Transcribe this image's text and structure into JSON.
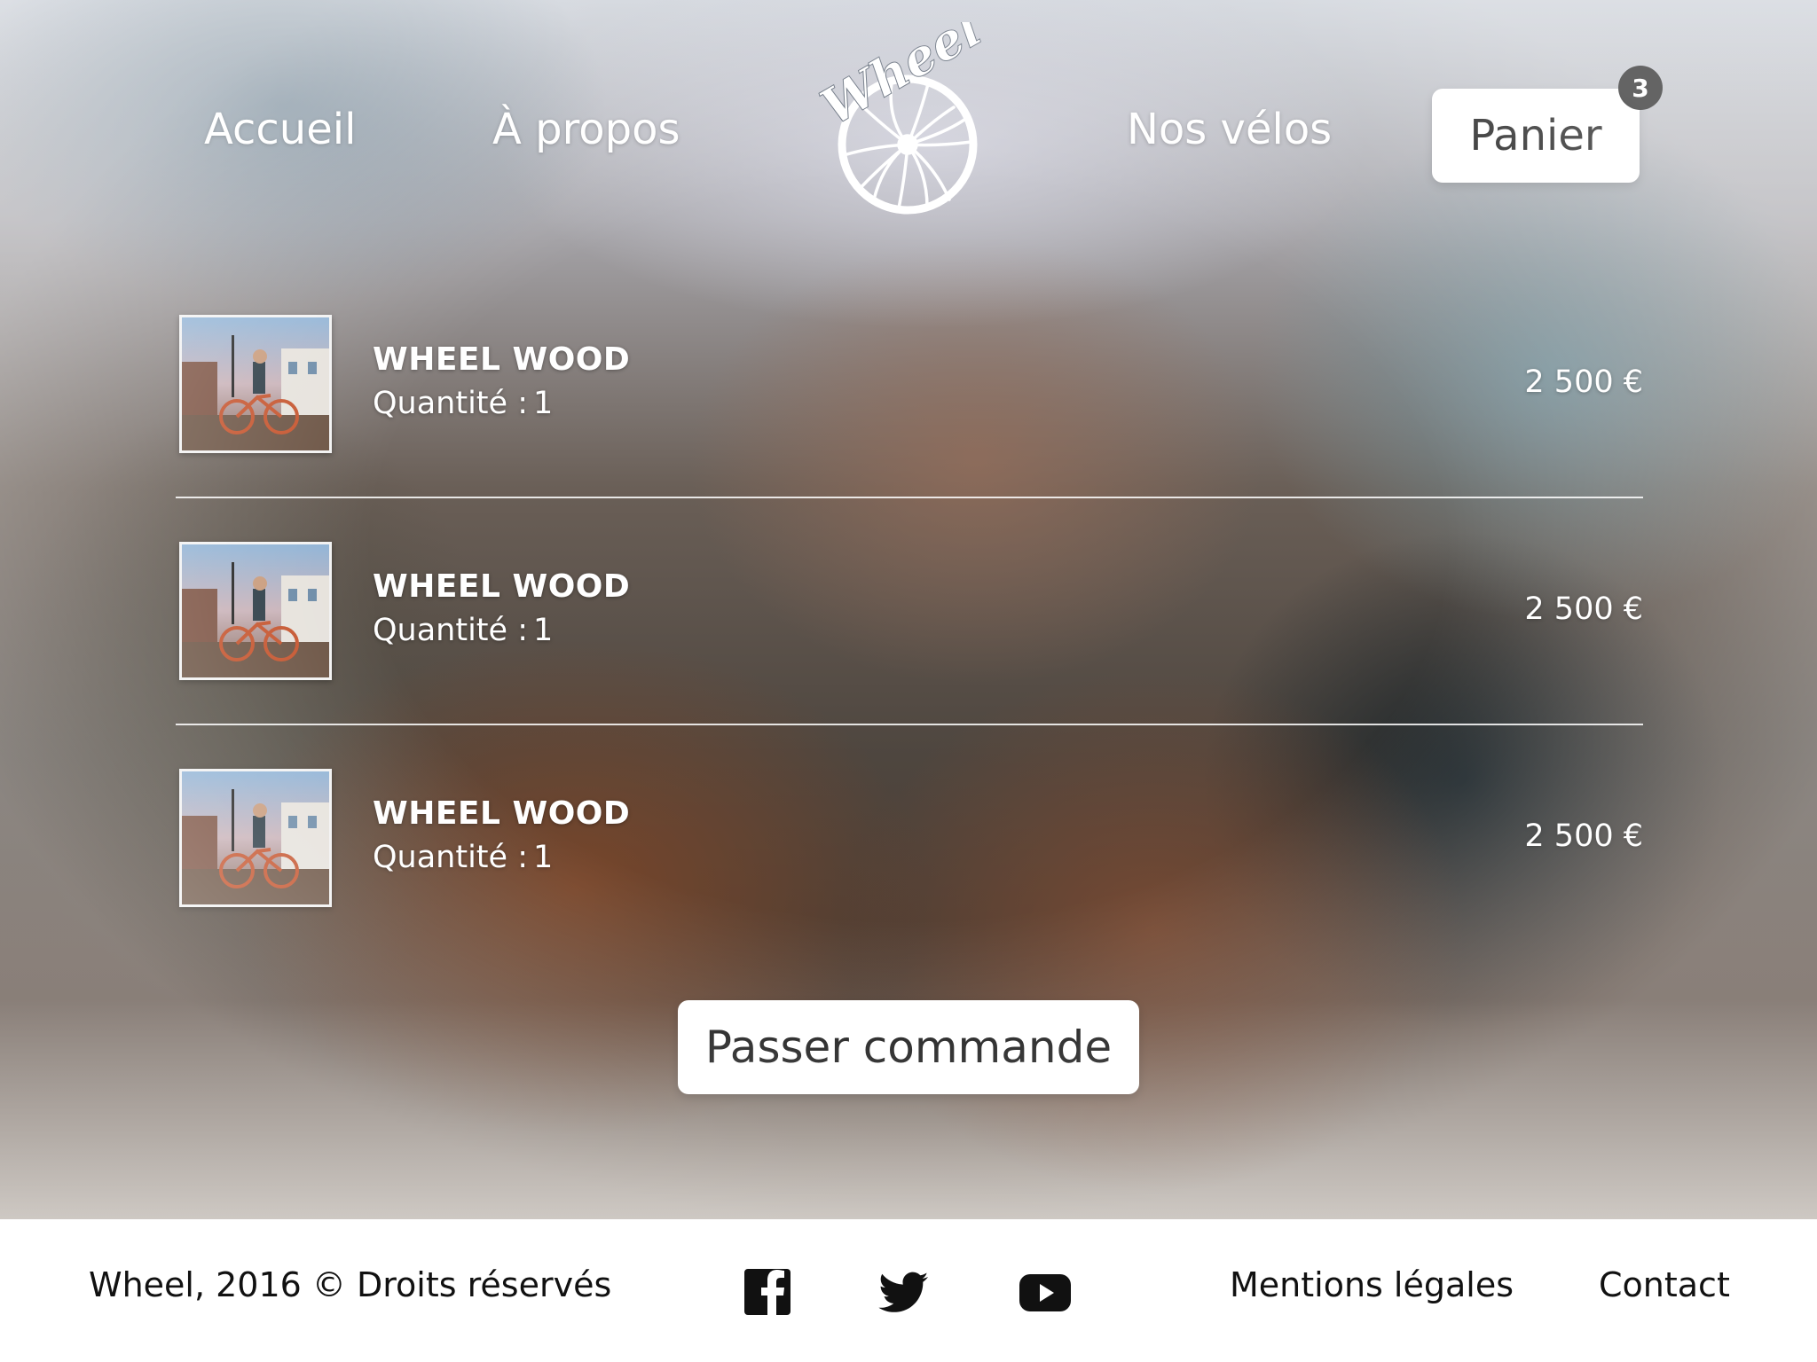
{
  "nav": {
    "home": "Accueil",
    "about": "À propos",
    "bikes": "Nos vélos",
    "cart": "Panier",
    "cart_count": "3",
    "logo_text": "Wheel"
  },
  "cart": {
    "items": [
      {
        "name": "WHEEL WOOD",
        "qty_label": "Quantité :",
        "qty": "1",
        "price": "2 500 €"
      },
      {
        "name": "WHEEL WOOD",
        "qty_label": "Quantité :",
        "qty": "1",
        "price": "2 500 €"
      },
      {
        "name": "WHEEL WOOD",
        "qty_label": "Quantité :",
        "qty": "1",
        "price": "2 500 €"
      }
    ],
    "order_button": "Passer commande"
  },
  "footer": {
    "copyright": "Wheel, 2016 © Droits réservés",
    "legal": "Mentions légales",
    "contact": "Contact",
    "social_icons": [
      "facebook-icon",
      "twitter-icon",
      "youtube-icon"
    ]
  },
  "colors": {
    "button_bg": "#ffffff",
    "text_dark": "#111111",
    "badge_bg": "#111111"
  }
}
